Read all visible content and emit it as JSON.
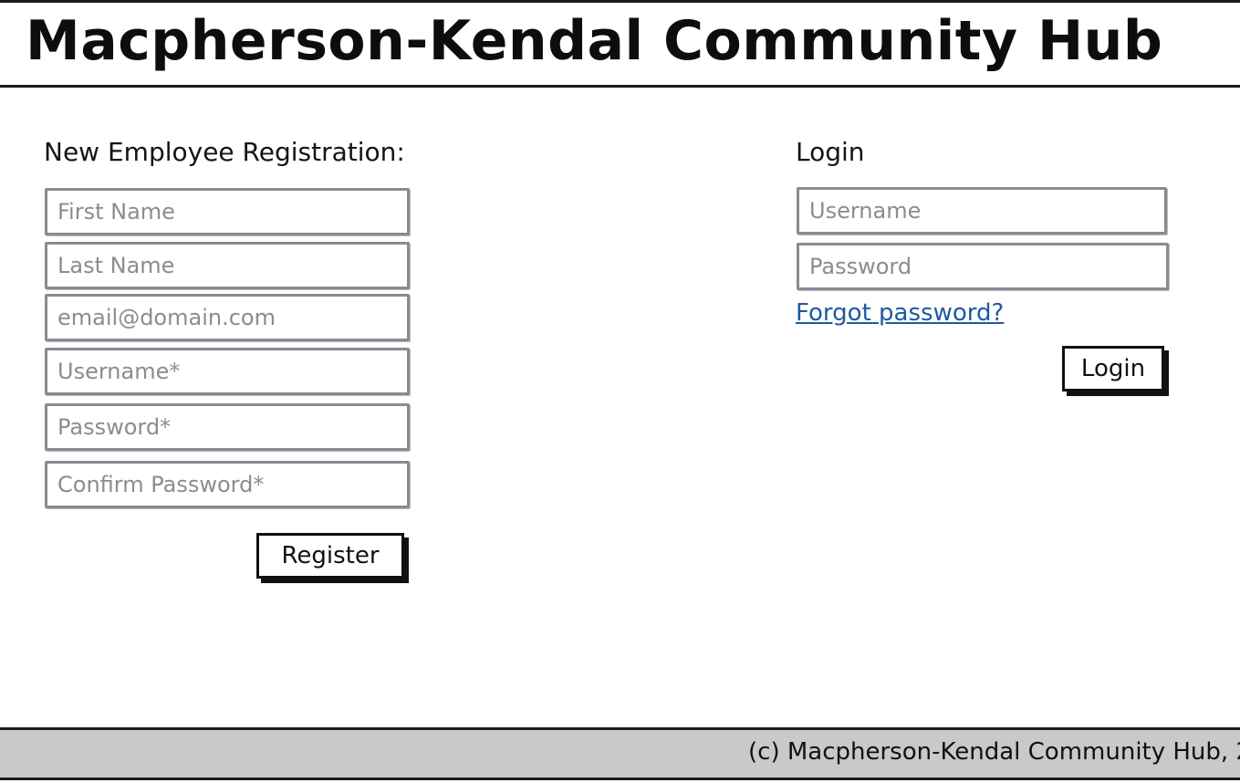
{
  "header": {
    "title": "Macpherson-Kendal Community Hub"
  },
  "registration": {
    "heading": "New Employee Registration:",
    "fields": [
      {
        "placeholder": "First Name"
      },
      {
        "placeholder": "Last Name"
      },
      {
        "placeholder": "email@domain.com"
      },
      {
        "placeholder": "Username*"
      },
      {
        "placeholder": "Password*"
      },
      {
        "placeholder": "Confirm Password*"
      }
    ],
    "submit_label": "Register"
  },
  "login": {
    "heading": "Login",
    "username_placeholder": "Username",
    "password_placeholder": "Password",
    "forgot_link": "Forgot password?",
    "submit_label": "Login"
  },
  "footer": {
    "text": "(c) Macpherson-Kendal Community Hub, 2"
  }
}
